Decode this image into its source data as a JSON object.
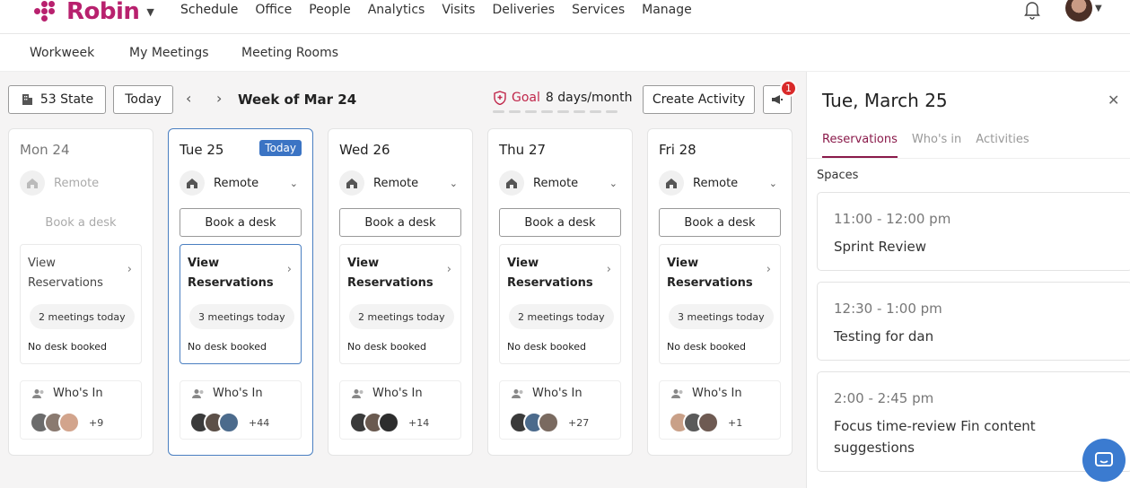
{
  "app": {
    "name": "Robin",
    "brand_color": "#b8216e"
  },
  "topnav": {
    "items": [
      "Schedule",
      "Office",
      "People",
      "Analytics",
      "Visits",
      "Deliveries",
      "Services",
      "Manage"
    ]
  },
  "subnav": {
    "items": [
      "Workweek",
      "My Meetings",
      "Meeting Rooms"
    ]
  },
  "toolbar": {
    "office": "53 State",
    "today": "Today",
    "week_label": "Week of Mar 24",
    "goal_label": "Goal",
    "goal_value": "8 days/month",
    "create_activity": "Create Activity",
    "notification_count": "1"
  },
  "days": [
    {
      "title": "Mon 24",
      "status": "Remote",
      "book": "Book a desk",
      "view1": "View",
      "view2": "Reservations",
      "meetings": "2 meetings today",
      "desk": "No desk booked",
      "who": "Who's In",
      "more": "+9"
    },
    {
      "title": "Tue 25",
      "badge": "Today",
      "status": "Remote",
      "book": "Book a desk",
      "view1": "View",
      "view2": "Reservations",
      "meetings": "3 meetings today",
      "desk": "No desk booked",
      "who": "Who's In",
      "more": "+44"
    },
    {
      "title": "Wed 26",
      "status": "Remote",
      "book": "Book a desk",
      "view1": "View",
      "view2": "Reservations",
      "meetings": "2 meetings today",
      "desk": "No desk booked",
      "who": "Who's In",
      "more": "+14"
    },
    {
      "title": "Thu 27",
      "status": "Remote",
      "book": "Book a desk",
      "view1": "View",
      "view2": "Reservations",
      "meetings": "2 meetings today",
      "desk": "No desk booked",
      "who": "Who's In",
      "more": "+27"
    },
    {
      "title": "Fri 28",
      "status": "Remote",
      "book": "Book a desk",
      "view1": "View",
      "view2": "Reservations",
      "meetings": "3 meetings today",
      "desk": "No desk booked",
      "who": "Who's In",
      "more": "+1"
    }
  ],
  "panel": {
    "title": "Tue, March 25",
    "tabs": [
      "Reservations",
      "Who's in",
      "Activities"
    ],
    "section": "Spaces",
    "events": [
      {
        "time": "11:00 - 12:00 pm",
        "name": "Sprint Review"
      },
      {
        "time": "12:30 - 1:00 pm",
        "name": "Testing for dan"
      },
      {
        "time": "2:00 - 2:45 pm",
        "name": "Focus time-review Fin content suggestions"
      }
    ]
  }
}
